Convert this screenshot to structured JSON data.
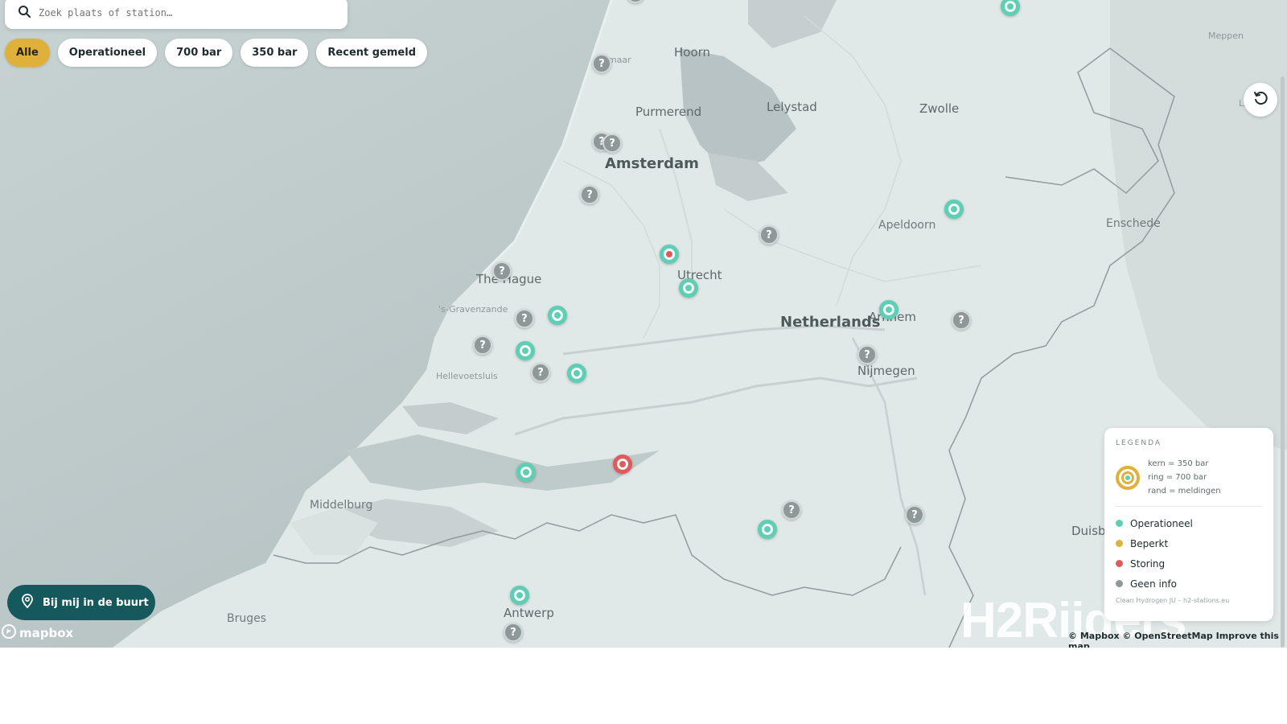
{
  "search": {
    "placeholder": "Zoek plaats of station…"
  },
  "filters": [
    {
      "label": "Alle",
      "active": true
    },
    {
      "label": "Operationeel",
      "active": false
    },
    {
      "label": "700 bar",
      "active": false
    },
    {
      "label": "350 bar",
      "active": false
    },
    {
      "label": "Recent gemeld",
      "active": false
    }
  ],
  "near_button": {
    "label": "Bij mij in de buurt"
  },
  "mapbox_logo": "mapbox",
  "places": {
    "alkmaar": "Alkmaar",
    "hoorn": "Hoorn",
    "purmerend": "Purmerend",
    "lelystad": "Lelystad",
    "zwolle": "Zwolle",
    "meppen": "Meppen",
    "lingen": "Linge",
    "amsterdam": "Amsterdam",
    "apeldoorn": "Apeldoorn",
    "enschede": "Enschede",
    "thehague": "The Hague",
    "sgravenzande": "'s-Gravenzande",
    "utrecht": "Utrecht",
    "netherlands": "Netherlands",
    "arnhem": "Arnhem",
    "hellevoetsluis": "Hellevoetsluis",
    "nijmegen": "Nijmegen",
    "middelburg": "Middelburg",
    "duisburg": "Duisb",
    "bruges": "Bruges",
    "antwerp": "Antwerp"
  },
  "legend": {
    "title": "LEGENDA",
    "explain": [
      "kern = 350 bar",
      "ring = 700 bar",
      "rand = meldingen"
    ],
    "items": [
      {
        "label": "Operationeel",
        "color": "#5ecfb4"
      },
      {
        "label": "Beperkt",
        "color": "#e0b13a"
      },
      {
        "label": "Storing",
        "color": "#e05a5a"
      },
      {
        "label": "Geen info",
        "color": "#8f9899"
      }
    ],
    "footer": "Clean Hydrogen JU – h2-stations.eu"
  },
  "watermark": "H2Rijders",
  "attribution": "© Mapbox © OpenStreetMap  Improve this map",
  "marker_glyph": "?",
  "stations": [
    {
      "status": "geen-info"
    },
    {
      "status": "operationeel"
    },
    {
      "status": "geen-info"
    },
    {
      "status": "geen-info"
    },
    {
      "status": "geen-info"
    },
    {
      "status": "geen-info"
    },
    {
      "status": "operationeel"
    },
    {
      "status": "geen-info"
    },
    {
      "status": "mix"
    },
    {
      "status": "geen-info"
    },
    {
      "status": "operationeel"
    },
    {
      "status": "geen-info"
    },
    {
      "status": "operationeel"
    },
    {
      "status": "operationeel"
    },
    {
      "status": "geen-info"
    },
    {
      "status": "geen-info"
    },
    {
      "status": "operationeel"
    },
    {
      "status": "geen-info"
    },
    {
      "status": "operationeel"
    },
    {
      "status": "geen-info"
    },
    {
      "status": "storing"
    },
    {
      "status": "operationeel"
    },
    {
      "status": "geen-info"
    },
    {
      "status": "operationeel"
    },
    {
      "status": "geen-info"
    },
    {
      "status": "operationeel"
    },
    {
      "status": "geen-info"
    }
  ]
}
